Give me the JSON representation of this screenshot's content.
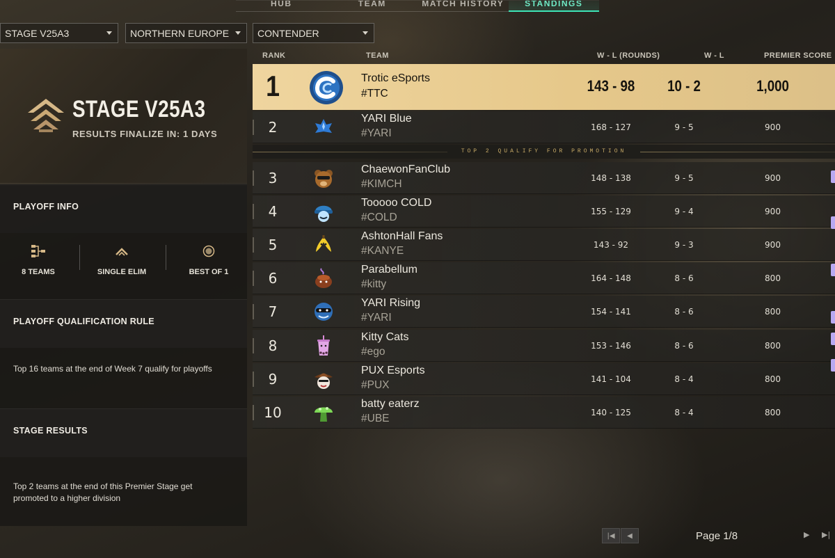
{
  "nav": {
    "tabs": [
      {
        "label": "HUB"
      },
      {
        "label": "TEAM"
      },
      {
        "label": "MATCH HISTORY"
      },
      {
        "label": "STANDINGS"
      }
    ],
    "active": "STANDINGS"
  },
  "filters": {
    "stage": "STAGE V25A3",
    "region": "NORTHERN EUROPE",
    "division": "CONTENDER"
  },
  "hero": {
    "title": "STAGE V25A3",
    "subtitle": "RESULTS FINALIZE IN: 1 DAYS"
  },
  "playoff_info": {
    "heading": "PLAYOFF INFO",
    "items": [
      {
        "label": "8 TEAMS",
        "icon": "bracket-icon"
      },
      {
        "label": "SINGLE ELIM",
        "icon": "chevron-up-icon"
      },
      {
        "label": "BEST OF 1",
        "icon": "circle-dot-icon"
      }
    ]
  },
  "qualification": {
    "heading": "PLAYOFF QUALIFICATION RULE",
    "text": "Top 16 teams at the end of Week 7 qualify for playoffs"
  },
  "stage_results": {
    "heading": "STAGE RESULTS",
    "text": "Top 2 teams at the end of this Premier Stage get promoted to a higher division"
  },
  "table": {
    "headers": {
      "rank": "RANK",
      "team": "TEAM",
      "rounds": "W - L (ROUNDS)",
      "wl": "W - L",
      "score": "PREMIER SCORE"
    },
    "promotion_divider": "TOP 2 QUALIFY FOR PROMOTION",
    "rows": [
      {
        "rank": "1",
        "name": "Trotic eSports",
        "tag": "#TTC",
        "rounds": "143 - 98",
        "wl": "10 - 2",
        "score": "1,000",
        "logo": "wave-c-logo-icon"
      },
      {
        "rank": "2",
        "name": "YARI Blue",
        "tag": "#YARI",
        "rounds": "168 - 127",
        "wl": "9 - 5",
        "score": "900",
        "logo": "blue-leaf-logo-icon"
      },
      {
        "rank": "3",
        "name": "ChaewonFanClub",
        "tag": "#KIMCH",
        "rounds": "148 - 138",
        "wl": "9 - 5",
        "score": "900",
        "logo": "bear-logo-icon"
      },
      {
        "rank": "4",
        "name": "Tooooo COLD",
        "tag": "#COLD",
        "rounds": "155 - 129",
        "wl": "9 - 4",
        "score": "900",
        "logo": "beanie-face-logo-icon"
      },
      {
        "rank": "5",
        "name": "AshtonHall Fans",
        "tag": "#KANYE",
        "rounds": "143 - 92",
        "wl": "9 - 3",
        "score": "900",
        "logo": "banana-logo-icon"
      },
      {
        "rank": "6",
        "name": "Parabellum",
        "tag": "#kitty",
        "rounds": "164 - 148",
        "wl": "8 - 6",
        "score": "800",
        "logo": "pudding-logo-icon"
      },
      {
        "rank": "7",
        "name": "YARI Rising",
        "tag": "#YARI",
        "rounds": "154 - 141",
        "wl": "8 - 6",
        "score": "800",
        "logo": "masked-face-logo-icon"
      },
      {
        "rank": "8",
        "name": "Kitty Cats",
        "tag": "#ego",
        "rounds": "153 - 146",
        "wl": "8 - 6",
        "score": "800",
        "logo": "bubble-tea-logo-icon"
      },
      {
        "rank": "9",
        "name": "PUX Esports",
        "tag": "#PUX",
        "rounds": "141 - 104",
        "wl": "8 - 4",
        "score": "800",
        "logo": "cowboy-face-logo-icon"
      },
      {
        "rank": "10",
        "name": "batty eaterz",
        "tag": "#UBE",
        "rounds": "140 - 125",
        "wl": "8 - 4",
        "score": "800",
        "logo": "mushroom-logo-icon"
      }
    ]
  },
  "pagination": {
    "text": "Page 1/8"
  },
  "colors": {
    "accent": "#3ee6b8",
    "highlight_row": "#e6c88a",
    "promo_text": "#c6a966"
  }
}
